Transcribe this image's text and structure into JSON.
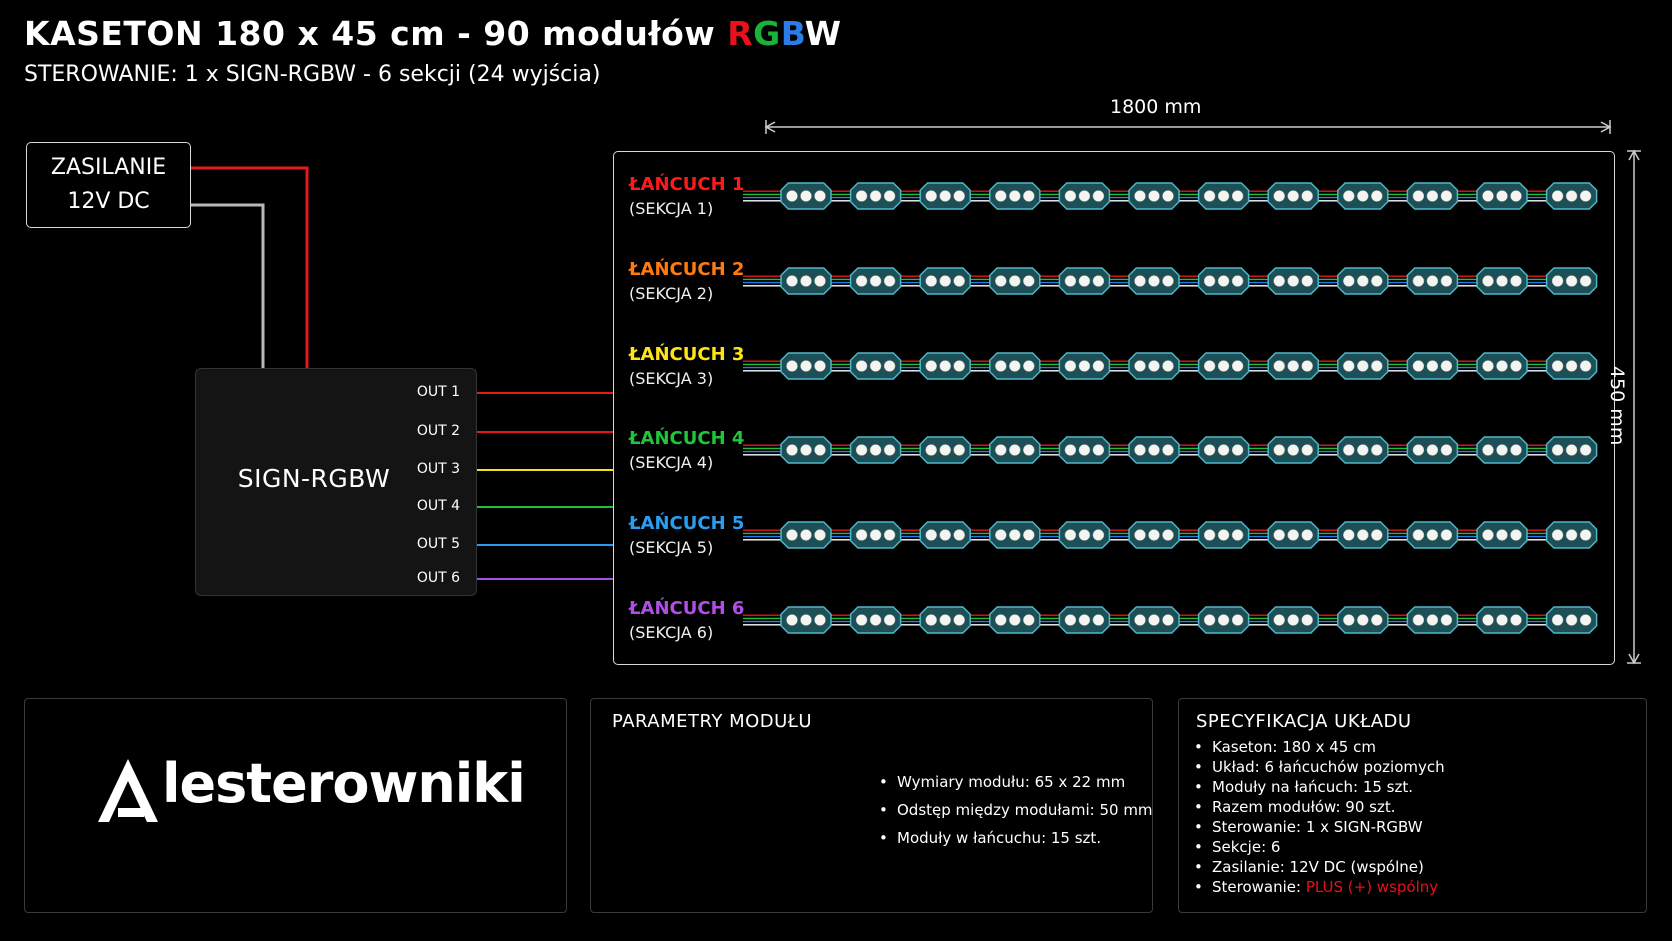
{
  "title": {
    "prefix": "KASETON 180 x 45 cm - 90 modułów ",
    "r": "R",
    "g": "G",
    "b": "B",
    "w": "W"
  },
  "subtitle": "STEROWANIE: 1 x SIGN-RGBW - 6 sekcji (24 wyjścia)",
  "colors": {
    "r": "#e8101a",
    "g": "#19b33a",
    "b": "#2a7de8",
    "w": "#ffffff",
    "wire_red": "#e41a1a",
    "wire_gray": "#b8b8b8",
    "accent_red": "#e8101a"
  },
  "psu": {
    "line1": "ZASILANIE",
    "line2": "12V DC"
  },
  "controller": {
    "name": "SIGN-RGBW",
    "outputs": [
      {
        "label": "OUT 1",
        "color": "#e41a1a"
      },
      {
        "label": "OUT 2",
        "color": "#e41a1a"
      },
      {
        "label": "OUT 3",
        "color": "#f5e11a"
      },
      {
        "label": "OUT 4",
        "color": "#1fbf3a"
      },
      {
        "label": "OUT 5",
        "color": "#2a9df0"
      },
      {
        "label": "OUT 6",
        "color": "#a64fe0"
      }
    ]
  },
  "dimensions": {
    "width": "1800 mm",
    "height": "450 mm"
  },
  "chains": [
    {
      "name": "ŁAŃCUCH 1",
      "section": "(SEKCJA 1)",
      "color": "#ff1a1a"
    },
    {
      "name": "ŁAŃCUCH 2",
      "section": "(SEKCJA 2)",
      "color": "#ff7a10"
    },
    {
      "name": "ŁAŃCUCH 3",
      "section": "(SEKCJA 3)",
      "color": "#ffe31a"
    },
    {
      "name": "ŁAŃCUCH 4",
      "section": "(SEKCJA 4)",
      "color": "#22c43a"
    },
    {
      "name": "ŁAŃCUCH 5",
      "section": "(SEKCJA 5)",
      "color": "#2a9df0"
    },
    {
      "name": "ŁAŃCUCH 6",
      "section": "(SEKCJA 6)",
      "color": "#b04fe8"
    }
  ],
  "modules_per_chain": 12,
  "logo": {
    "text": "lesterowniki"
  },
  "params": {
    "title": "PARAMETRY MODUŁU",
    "items": [
      "Wymiary modułu: 65 x 22 mm",
      "Odstęp między modułami: 50 mm",
      "Moduły w łańcuchu:  15 szt."
    ]
  },
  "spec": {
    "title": "SPECYFIKACJA UKŁADU",
    "items": [
      "Kaseton:  180 x 45 cm",
      "Układ:  6 łańcuchów poziomych",
      "Moduły na łańcuch:  15 szt.",
      "Razem modułów:  90 szt.",
      "Sterowanie:  1 x SIGN-RGBW",
      "Sekcje:  6",
      "Zasilanie:  12V DC (wspólne)"
    ],
    "last_label": "Sterowanie:  ",
    "last_value": "PLUS (+) wspólny"
  }
}
